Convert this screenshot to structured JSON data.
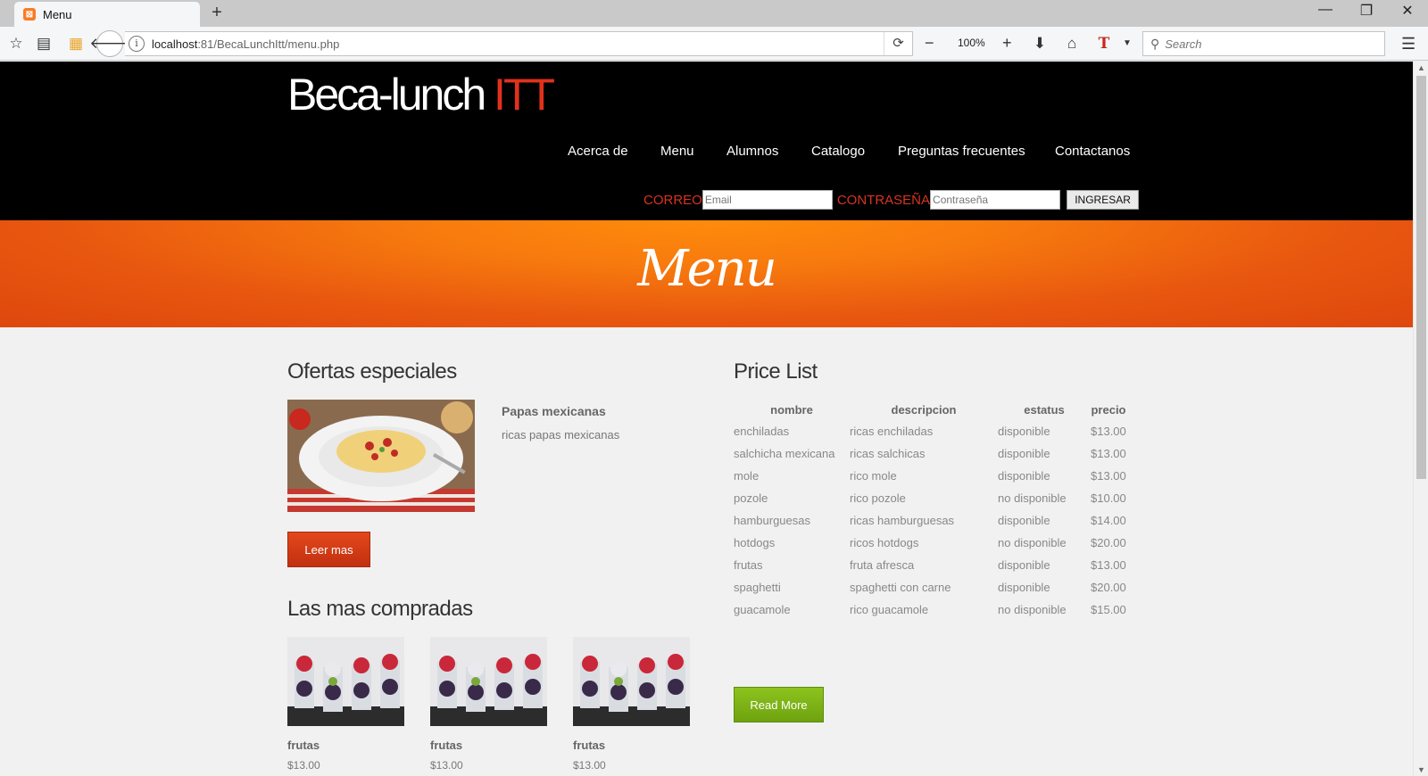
{
  "browser": {
    "tab_title": "Menu",
    "new_tab": "+",
    "url_host": "localhost",
    "url_path": ":81/BecaLunchItt/menu.php",
    "zoom": "100%",
    "search_placeholder": "Search",
    "win_minimize": "—",
    "win_restore": "❐",
    "win_close": "✕"
  },
  "header": {
    "logo_main": "Beca-lunch ",
    "logo_accent": "ITT",
    "nav": [
      "Acerca de",
      "Menu",
      "Alumnos",
      "Catalogo",
      "Preguntas frecuentes",
      "Contactanos"
    ],
    "login": {
      "email_label": "CORREO",
      "email_placeholder": "Email",
      "password_label": "CONTRASEÑA",
      "password_placeholder": "Contraseña",
      "submit_label": "INGRESAR"
    }
  },
  "banner": {
    "title": "Menu"
  },
  "offers": {
    "heading": "Ofertas especiales",
    "item_name": "Papas mexicanas",
    "item_desc": "ricas papas mexicanas",
    "button_label": "Leer mas"
  },
  "top_sellers": {
    "heading": "Las mas compradas",
    "items": [
      {
        "name": "frutas",
        "price": "$13.00"
      },
      {
        "name": "frutas",
        "price": "$13.00"
      },
      {
        "name": "frutas",
        "price": "$13.00"
      }
    ]
  },
  "price_list": {
    "heading": "Price List",
    "columns": [
      "nombre",
      "descripcion",
      "estatus",
      "precio"
    ],
    "rows": [
      [
        "enchiladas",
        "ricas enchiladas",
        "disponible",
        "$13.00"
      ],
      [
        "salchicha mexicana",
        "ricas salchicas",
        "disponible",
        "$13.00"
      ],
      [
        "mole",
        "rico mole",
        "disponible",
        "$13.00"
      ],
      [
        "pozole",
        "rico pozole",
        "no disponible",
        "$10.00"
      ],
      [
        "hamburguesas",
        "ricas hamburguesas",
        "disponible",
        "$14.00"
      ],
      [
        "hotdogs",
        "ricos hotdogs",
        "no disponible",
        "$20.00"
      ],
      [
        "frutas",
        "fruta afresca",
        "disponible",
        "$13.00"
      ],
      [
        "spaghetti",
        "spaghetti con carne",
        "disponible",
        "$20.00"
      ],
      [
        "guacamole",
        "rico guacamole",
        "no disponible",
        "$15.00"
      ]
    ],
    "button_label": "Read More"
  },
  "colors": {
    "accent_red": "#e2311b",
    "banner_orange": "#f77a0e",
    "button_green": "#7db516"
  }
}
